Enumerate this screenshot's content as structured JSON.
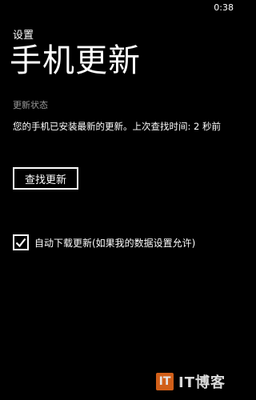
{
  "status_bar": {
    "time": "0:38"
  },
  "header": {
    "app_title": "设置",
    "page_title": "手机更新"
  },
  "update_status": {
    "label": "更新状态",
    "message": "您的手机已安装最新的更新。上次查找时间: 2 秒前"
  },
  "actions": {
    "check_button": "查找更新"
  },
  "auto_download": {
    "checked": true,
    "label": "自动下载更新(如果我的数据设置允许)"
  },
  "watermark": {
    "logo_text": "IT",
    "text": "IT博客"
  }
}
